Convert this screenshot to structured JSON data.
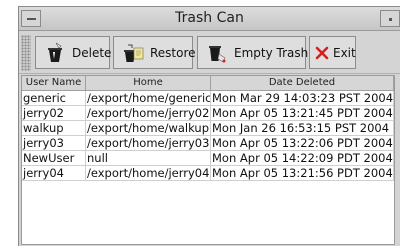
{
  "window": {
    "title": "Trash Can"
  },
  "toolbar": {
    "delete_label": "Delete",
    "restore_label": "Restore",
    "empty_label": "Empty Trash",
    "exit_label": "Exit"
  },
  "icons": {
    "delete": "trash-delete-icon",
    "restore": "restore-icon",
    "empty": "empty-trash-icon",
    "exit": "red-x-icon"
  },
  "colors": {
    "exit_x": "#d42020"
  },
  "table": {
    "headers": [
      "User Name",
      "Home",
      "Date Deleted"
    ],
    "rows": [
      [
        "generic",
        "/export/home/generic",
        "Mon Mar 29 14:03:23 PST 2004"
      ],
      [
        "jerry02",
        "/export/home/jerry02",
        "Mon Apr 05 13:21:45 PDT 2004"
      ],
      [
        "walkup",
        "/export/home/walkup",
        "Mon Jan 26 16:53:15 PST 2004"
      ],
      [
        "jerry03",
        "/export/home/jerry03",
        "Mon Apr 05 13:22:06 PDT 2004"
      ],
      [
        "NewUser",
        "null",
        "Mon Apr 05 14:22:09 PDT 2004"
      ],
      [
        "jerry04",
        "/export/home/jerry04",
        "Mon Apr 05 13:21:56 PDT 2004"
      ]
    ]
  }
}
